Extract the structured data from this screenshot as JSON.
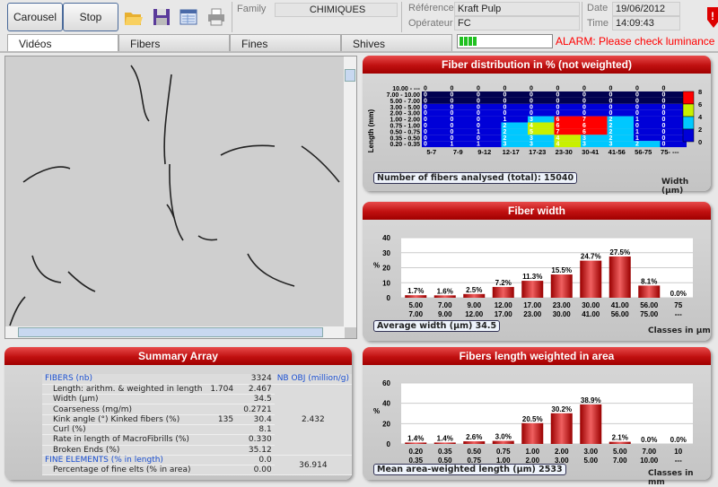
{
  "toolbar": {
    "carousel": "Carousel",
    "stop": "Stop",
    "icons": [
      "open-folder-icon",
      "save-icon",
      "table-icon",
      "print-icon"
    ],
    "family_label": "Family",
    "family": "CHIMIQUES",
    "reference_label": "Référence",
    "reference": "Kraft Pulp",
    "operator_label": "Opérateur",
    "operator": "FC",
    "date_label": "Date",
    "date": "19/06/2012",
    "time_label": "Time",
    "time": "14:09:43"
  },
  "tabs": [
    {
      "label": "Vidéos",
      "active": true
    },
    {
      "label": "Fibers"
    },
    {
      "label": "Fines"
    },
    {
      "label": "Shives"
    }
  ],
  "status": {
    "signal_level": 0.25,
    "alarm": "ALARM: Please check luminance",
    "alarm_color": "#ff0000"
  },
  "summary": {
    "title": "Summary Array",
    "rows": [
      {
        "label": "FIBERS  (nb)",
        "v1": "",
        "v2": "3324",
        "header": true
      },
      {
        "label": "Length: arithm. & weighted in length",
        "v1": "1.704",
        "v2": "2.467"
      },
      {
        "label": "Width (µm)",
        "v1": "",
        "v2": "34.5"
      },
      {
        "label": "Coarseness (mg/m)",
        "v1": "",
        "v2": "0.2721"
      },
      {
        "label": "Kink angle (°)   Kinked fibers (%)",
        "v1": "135",
        "v2": "30.4"
      },
      {
        "label": "Curl (%)",
        "v1": "",
        "v2": "8.1"
      },
      {
        "label": "Rate in length of MacroFibrills (%)",
        "v1": "",
        "v2": "0.330"
      },
      {
        "label": "Broken Ends (%)",
        "v1": "",
        "v2": "35.12"
      },
      {
        "label": "FINE ELEMENTS  (% in length)",
        "v1": "",
        "v2": "0.0",
        "header": true
      },
      {
        "label": "Percentage of fine elts (% in area)",
        "v1": "",
        "v2": "0.00"
      }
    ],
    "nbobj_label": "NB OBJ (million/g)",
    "nbobj_fibers": "2.432",
    "nbobj_fines": "36.914"
  },
  "chart_data": [
    {
      "type": "heatmap",
      "title": "Fiber distribution in % (not weighted)",
      "ylabel": "Length (mm)",
      "xlabel": "Width (µm)",
      "x": [
        "5-7",
        "7-9",
        "9-12",
        "12-17",
        "17-23",
        "23-30",
        "30-41",
        "41-56",
        "56-75",
        "75- ---"
      ],
      "y": [
        "10.00 - ---",
        "7.00 - 10.00",
        "5.00 - 7.00",
        "3.00 - 5.00",
        "2.00 - 3.00",
        "1.00 - 2.00",
        "0.75 - 1.00",
        "0.50 - 0.75",
        "0.35 - 0.50",
        "0.20 - 0.35"
      ],
      "values": [
        [
          0,
          0,
          0,
          0,
          0,
          0,
          0,
          0,
          0,
          0
        ],
        [
          0,
          0,
          0,
          0,
          0,
          0,
          0,
          0,
          0,
          0
        ],
        [
          0,
          0,
          0,
          0,
          0,
          0,
          0,
          0,
          0,
          0
        ],
        [
          0,
          0,
          0,
          0,
          0,
          0,
          0,
          0,
          0,
          0
        ],
        [
          0,
          0,
          0,
          0,
          0,
          0,
          0,
          0,
          0,
          0
        ],
        [
          0,
          0,
          0,
          1,
          3,
          6,
          7,
          2,
          1,
          0
        ],
        [
          0,
          0,
          0,
          2,
          4,
          6,
          6,
          2,
          0,
          0
        ],
        [
          0,
          0,
          1,
          2,
          5,
          7,
          6,
          2,
          1,
          0
        ],
        [
          0,
          0,
          0,
          2,
          3,
          4,
          3,
          2,
          1,
          0
        ],
        [
          0,
          1,
          1,
          3,
          3,
          4,
          3,
          3,
          2,
          0
        ]
      ],
      "colorbar": {
        "ticks": [
          "8",
          "6",
          "4",
          "2",
          "0"
        ],
        "colors": [
          "#ff0000",
          "#c8f000",
          "#00c8ff",
          "#0000d8"
        ]
      },
      "note": "Number of fibers analysed (total): 15040"
    },
    {
      "type": "bar",
      "title": "Fiber width",
      "ylabel": "%",
      "xlabel": "Classes in µm",
      "ylim": [
        0,
        40
      ],
      "yticks": [
        "0",
        "10",
        "20",
        "30",
        "40"
      ],
      "categories": [
        [
          "5.00",
          "7.00"
        ],
        [
          "7.00",
          "9.00"
        ],
        [
          "9.00",
          "12.00"
        ],
        [
          "12.00",
          "17.00"
        ],
        [
          "17.00",
          "23.00"
        ],
        [
          "23.00",
          "30.00"
        ],
        [
          "30.00",
          "41.00"
        ],
        [
          "41.00",
          "56.00"
        ],
        [
          "56.00",
          "75.00"
        ],
        [
          "75",
          "---"
        ]
      ],
      "values": [
        1.7,
        1.6,
        2.5,
        7.2,
        11.3,
        15.5,
        24.7,
        27.5,
        8.1,
        0.0
      ],
      "labels": [
        "1.7%",
        "1.6%",
        "2.5%",
        "7.2%",
        "11.3%",
        "15.5%",
        "24.7%",
        "27.5%",
        "8.1%",
        "0.0%"
      ],
      "note": "Average width (µm) 34.5"
    },
    {
      "type": "bar",
      "title": "Fibers length weighted in area",
      "ylabel": "%",
      "xlabel": "Classes in mm",
      "ylim": [
        0,
        60
      ],
      "yticks": [
        "0",
        "20",
        "40",
        "60"
      ],
      "categories": [
        [
          "0.20",
          "0.35"
        ],
        [
          "0.35",
          "0.50"
        ],
        [
          "0.50",
          "0.75"
        ],
        [
          "0.75",
          "1.00"
        ],
        [
          "1.00",
          "2.00"
        ],
        [
          "2.00",
          "3.00"
        ],
        [
          "3.00",
          "5.00"
        ],
        [
          "5.00",
          "7.00"
        ],
        [
          "7.00",
          "10.00"
        ],
        [
          "10",
          "---"
        ]
      ],
      "values": [
        1.4,
        1.4,
        2.6,
        3.0,
        20.5,
        30.2,
        38.9,
        2.1,
        0.0,
        0.0
      ],
      "labels": [
        "1.4%",
        "1.4%",
        "2.6%",
        "3.0%",
        "20.5%",
        "30.2%",
        "38.9%",
        "2.1%",
        "0.0%",
        "0.0%"
      ],
      "note": "Mean area-weighted length (µm) 2533"
    }
  ]
}
